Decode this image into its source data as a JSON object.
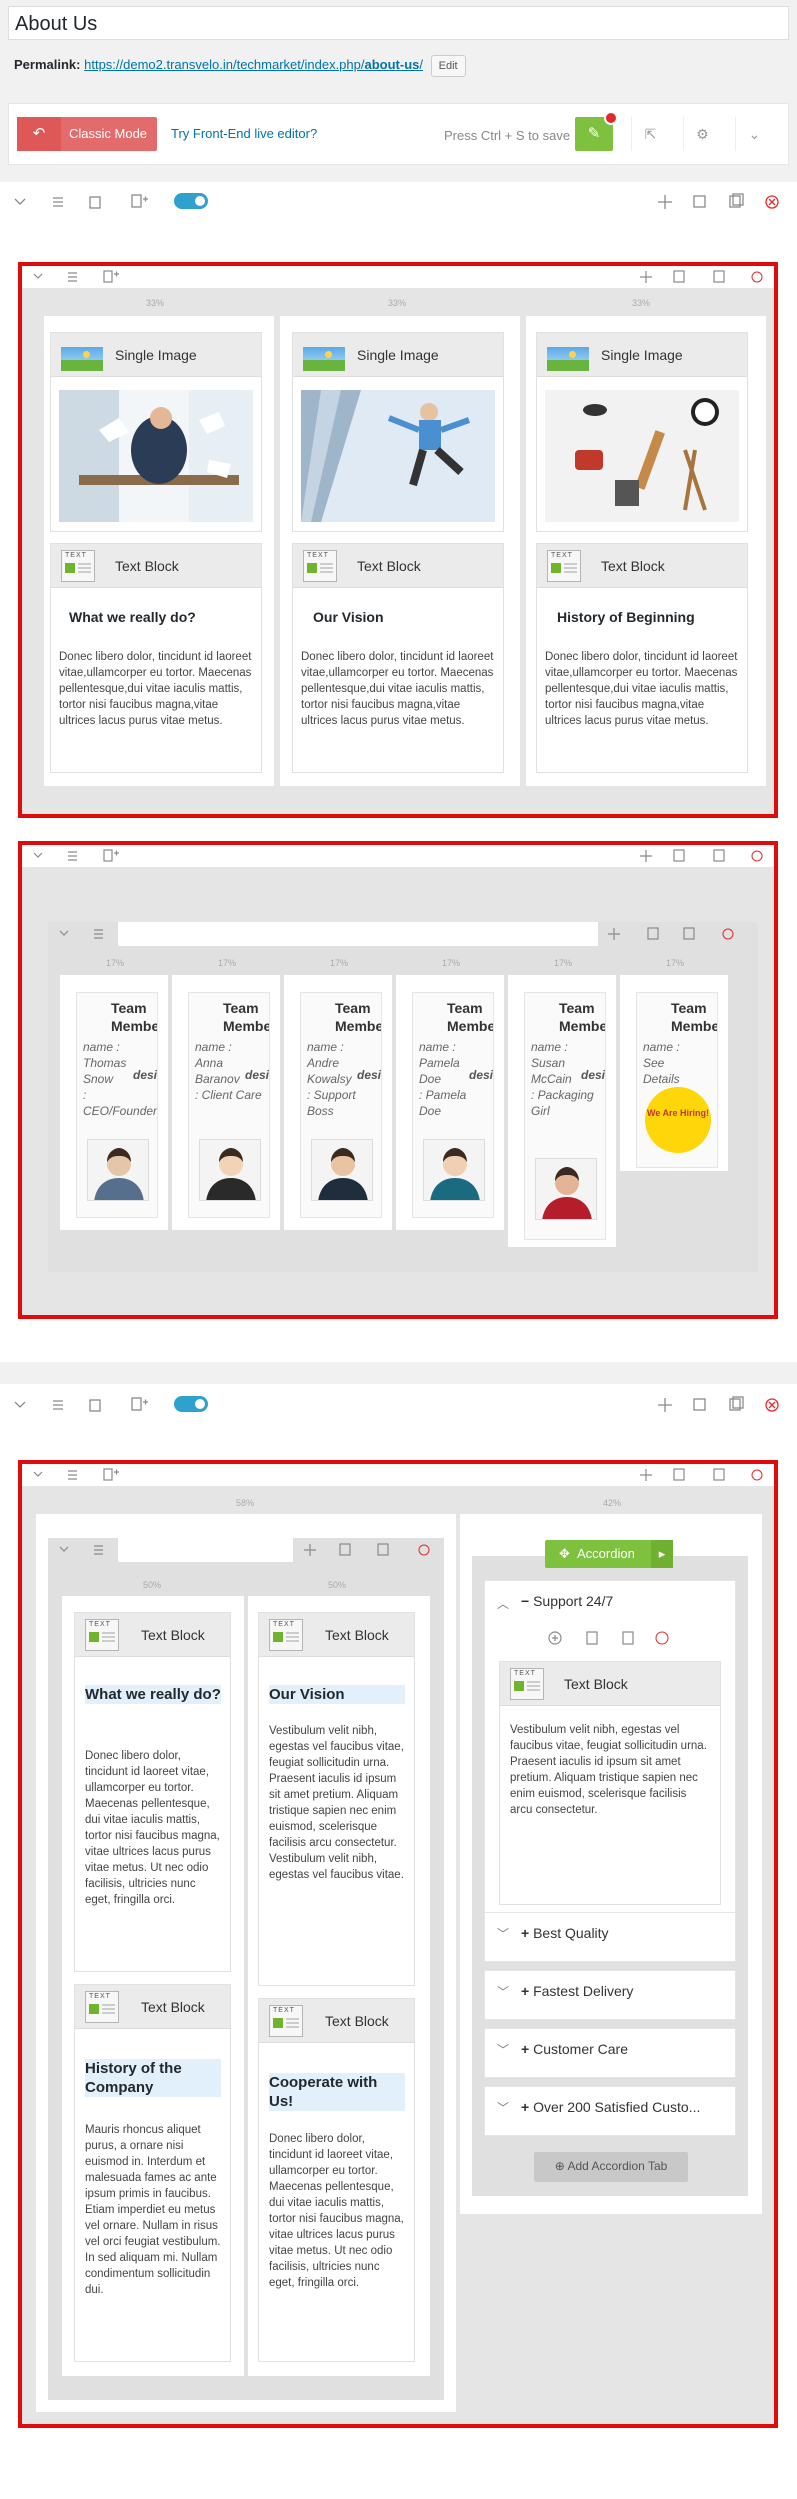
{
  "page": {
    "title": "About Us"
  },
  "permalink": {
    "label": "Permalink:",
    "url_base": "https://demo2.transvelo.in/techmarket/index.php/",
    "slug": "about-us",
    "trail": "/",
    "edit": "Edit"
  },
  "toolbar": {
    "classic_mode": "Classic Mode",
    "frontend_link": "Try Front-End live editor?",
    "save_hint": "Press Ctrl + S to save"
  },
  "row1": {
    "cols": [
      {
        "pct": "33%",
        "image_label": "Single Image",
        "text_label": "Text Block",
        "heading": "What we really do?",
        "body": "Donec libero dolor, tincidunt id laoreet vitae,ullamcorper eu tortor. Maecenas pellentesque,dui vitae iaculis mattis, tortor nisi faucibus magna,vitae ultrices lacus purus vitae metus."
      },
      {
        "pct": "33%",
        "image_label": "Single Image",
        "text_label": "Text Block",
        "heading": "Our Vision",
        "body": "Donec libero dolor, tincidunt id laoreet vitae,ullamcorper eu tortor. Maecenas pellentesque,dui vitae iaculis mattis, tortor nisi faucibus magna,vitae ultrices lacus purus vitae metus."
      },
      {
        "pct": "33%",
        "image_label": "Single Image",
        "text_label": "Text Block",
        "heading": "History of Beginning",
        "body": "Donec libero dolor, tincidunt id laoreet vitae,ullamcorper eu tortor. Maecenas pellentesque,dui vitae iaculis mattis, tortor nisi faucibus magna,vitae ultrices lacus purus vitae metus."
      }
    ]
  },
  "row2": {
    "members": [
      {
        "pct": "17%",
        "head1": "Team",
        "head2": "Membe",
        "name_label": "name :",
        "name": "Thomas Snow",
        "designation": "designatio",
        "role": ": CEO/Founder"
      },
      {
        "pct": "17%",
        "head1": "Team",
        "head2": "Membe",
        "name_label": "name :",
        "name": "Anna Baranov",
        "designation": "designati",
        "role": ": Client Care"
      },
      {
        "pct": "17%",
        "head1": "Team",
        "head2": "Membe",
        "name_label": "name :",
        "name": "Andre Kowalsy",
        "designation": "designa",
        "role": ": Support Boss"
      },
      {
        "pct": "17%",
        "head1": "Team",
        "head2": "Membe",
        "name_label": "name :",
        "name": "Pamela Doe",
        "designation": "designatio",
        "role": ": Pamela Doe"
      },
      {
        "pct": "17%",
        "head1": "Team",
        "head2": "Membe",
        "name_label": "name :",
        "name": "Susan McCain",
        "designation": "designati",
        "role": ": Packaging Girl"
      },
      {
        "pct": "17%",
        "head1": "Team",
        "head2": "Membe",
        "name_label": "name :",
        "name": "See Details",
        "designation": "",
        "role": "",
        "hiring": "We Are Hiring!"
      }
    ]
  },
  "row3": {
    "left_pct": "58%",
    "right_pct": "42%",
    "inner_pcts": [
      "50%",
      "50%"
    ],
    "blocks": [
      {
        "label": "Text Block",
        "heading": "What we really do?",
        "body": "Donec libero dolor, tincidunt id laoreet vitae, ullamcorper eu tortor. Maecenas pellentesque, dui vitae iaculis mattis, tortor nisi faucibus magna, vitae ultrices lacus purus vitae metus. Ut nec odio facilisis, ultricies nunc eget, fringilla orci."
      },
      {
        "label": "Text Block",
        "heading": "Our Vision",
        "body": "Vestibulum velit nibh, egestas vel faucibus vitae, feugiat sollicitudin urna. Praesent iaculis id ipsum sit amet pretium. Aliquam tristique sapien nec enim euismod, scelerisque facilisis arcu consectetur. Vestibulum velit nibh, egestas vel faucibus vitae."
      },
      {
        "label": "Text Block",
        "heading": "History of the Company",
        "body": "Mauris rhoncus aliquet purus, a ornare nisi euismod in. Interdum et malesuada fames ac ante ipsum primis in faucibus. Etiam imperdiet eu metus vel ornare. Nullam in risus vel orci feugiat vestibulum. In sed aliquam mi. Nullam condimentum sollicitudin dui."
      },
      {
        "label": "Text Block",
        "heading": "Cooperate with Us!",
        "body": "Donec libero dolor, tincidunt id laoreet vitae, ullamcorper eu tortor. Maecenas pellentesque, dui vitae iaculis mattis, tortor nisi faucibus magna, vitae ultrices lacus purus vitae metus. Ut nec odio facilisis, ultricies nunc eget, fringilla orci."
      }
    ],
    "accordion": {
      "label": "Accordion",
      "open_item": "Support 24/7",
      "open_block_label": "Text Block",
      "open_body": "Vestibulum velit nibh, egestas vel faucibus vitae, feugiat sollicitudin urna. Praesent iaculis id ipsum sit amet pretium. Aliquam tristique sapien nec enim euismod, scelerisque facilisis arcu consectetur.",
      "items": [
        "Best Quality",
        "Fastest Delivery",
        "Customer Care",
        "Over 200 Satisfied Custo..."
      ],
      "add_tab": "Add Accordion Tab"
    }
  },
  "colors": {
    "red_outline": "#e20b0b",
    "classic": "#e36b6b",
    "save": "#7ec13e",
    "accordion": "#7ec13e",
    "link": "#0073aa"
  }
}
